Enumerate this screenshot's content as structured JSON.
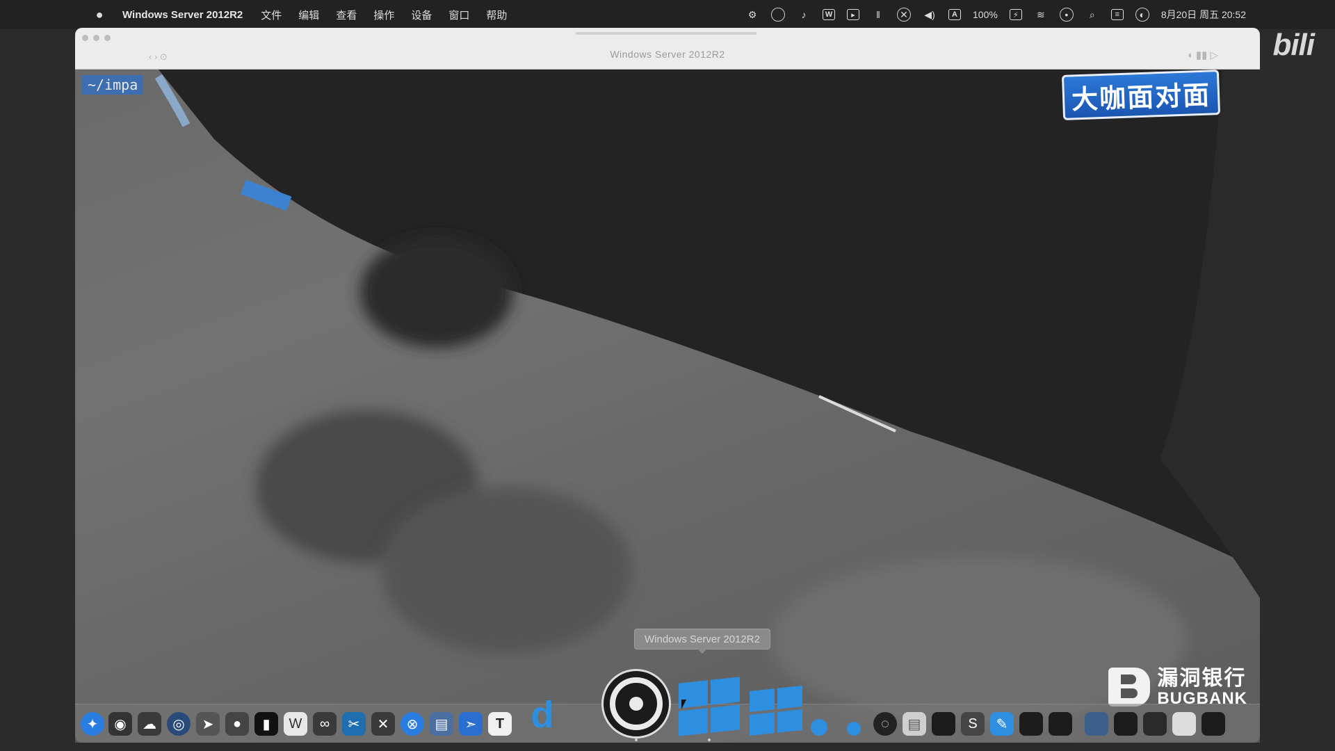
{
  "menubar": {
    "app_name": "Windows Server 2012R2",
    "menus": [
      "文件",
      "编辑",
      "查看",
      "操作",
      "设备",
      "窗口",
      "帮助"
    ],
    "battery": "100%",
    "datetime": "8月20日 周五 20:52",
    "status_icons": [
      "gear-icon",
      "browser-icon",
      "bell-icon",
      "w-icon",
      "folder-icon",
      "pause-icon",
      "globe-icon",
      "volume-icon",
      "input-a-icon",
      "battery-icon",
      "wifi-icon",
      "user-icon",
      "search-icon",
      "control-center-icon",
      "siri-icon"
    ]
  },
  "window": {
    "title": "Windows Server 2012R2"
  },
  "vm": {
    "path_label": "~/impa"
  },
  "overlays": {
    "talk_logo": "大咖面对面",
    "bugbank_cn": "漏洞银行",
    "bugbank_en": "BUGBANK",
    "bili": "bili"
  },
  "dock": {
    "tooltip": "Windows Server 2012R2",
    "accent": "#2e8fe0"
  }
}
